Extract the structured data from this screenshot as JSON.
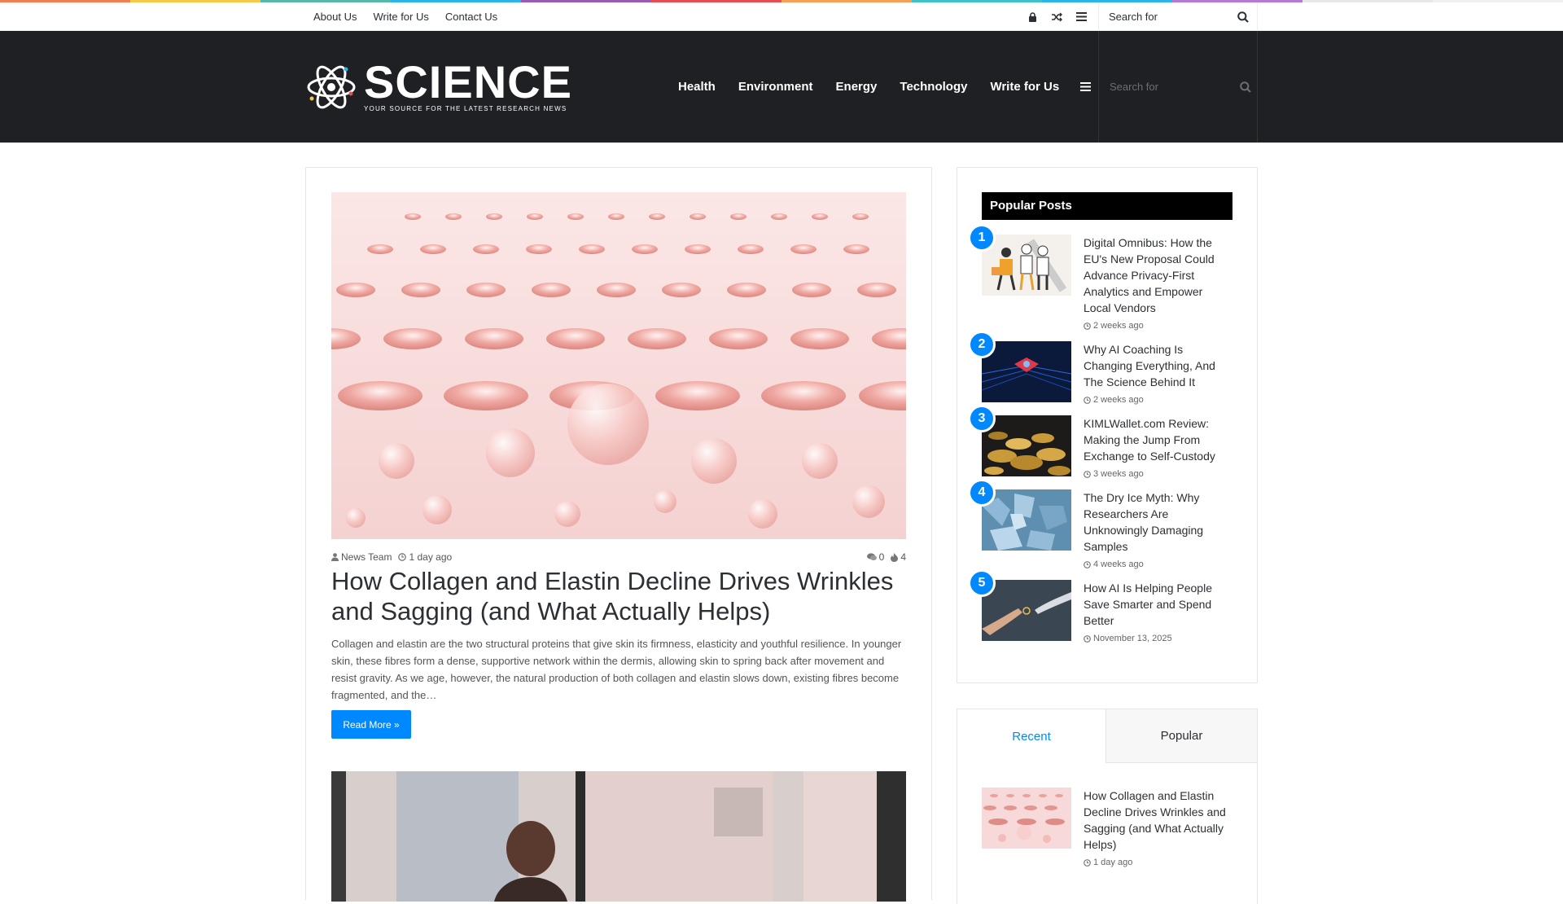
{
  "colors": {
    "accent": "#0088ff",
    "header_bg": "#1f2024",
    "rainbow": [
      "#f37d53",
      "#f7c948",
      "#55b8aa",
      "#2db4e8",
      "#9b59b6",
      "#e44c56",
      "#f79f56",
      "#3fc1c9",
      "#2db4e8",
      "#b779d8",
      "#e8e8e8",
      "#f0f0f0"
    ]
  },
  "topbar": {
    "links": [
      "About Us",
      "Write for Us",
      "Contact Us"
    ],
    "icons": [
      "lock-icon",
      "random-icon",
      "menu-icon"
    ],
    "search_placeholder": "Search for"
  },
  "header": {
    "logo_title": "SCIENCE",
    "logo_tagline": "YOUR SOURCE FOR THE LATEST RESEARCH NEWS",
    "nav": [
      "Health",
      "Environment",
      "Energy",
      "Technology",
      "Write for Us"
    ],
    "search_placeholder": "Search for"
  },
  "post": {
    "author": "News Team",
    "date": "1 day ago",
    "comments": "0",
    "views": "4",
    "title": "How Collagen and Elastin Decline Drives Wrinkles and Sagging (and What Actually Helps)",
    "excerpt": "Collagen and elastin are the two structural proteins that give skin its firmness, elasticity and youthful resilience. In younger skin, these fibres form a dense, supportive network within the dermis, allowing skin to spring back after movement and resist gravity. As we age, however, the natural production of both collagen and elastin slows down, existing fibres become fragmented, and the…",
    "read_more": "Read More »"
  },
  "sidebar": {
    "popular_title": "Popular Posts",
    "popular": [
      {
        "num": "1",
        "title": "Digital Omnibus: How the EU's New Proposal Could Advance Privacy-First Analytics and Empower Local Vendors",
        "date": "2 weeks ago"
      },
      {
        "num": "2",
        "title": "Why AI Coaching Is Changing Everything, And The  Science Behind It",
        "date": "2 weeks ago"
      },
      {
        "num": "3",
        "title": "KIMLWallet.com Review: Making the Jump From Exchange to Self-Custody",
        "date": "3 weeks ago"
      },
      {
        "num": "4",
        "title": "The Dry Ice Myth: Why Researchers Are Unknowingly Damaging Samples",
        "date": "4 weeks ago"
      },
      {
        "num": "5",
        "title": "How AI Is Helping People Save Smarter and Spend Better",
        "date": "November 13, 2025"
      }
    ],
    "tabs": [
      "Recent",
      "Popular"
    ],
    "recent": {
      "title": "How Collagen and Elastin Decline Drives Wrinkles and Sagging (and What Actually Helps)",
      "date": "1 day ago"
    }
  }
}
